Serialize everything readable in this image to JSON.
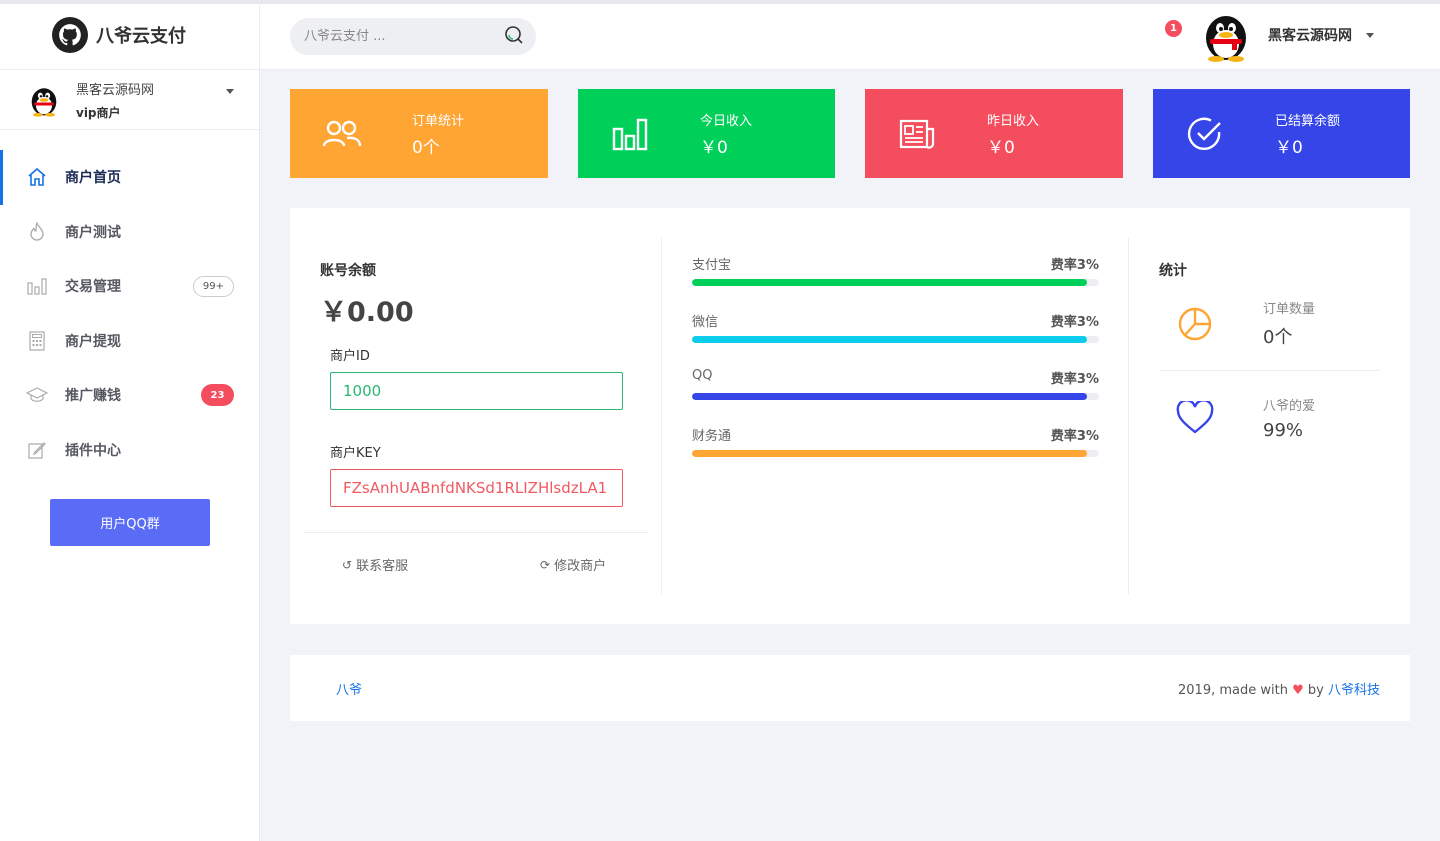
{
  "app": {
    "brand_title": "八爷云支付",
    "search_placeholder": "八爷云支付 ...",
    "notification_count": "1",
    "top_user_name": "黑客云源码网"
  },
  "sidebar": {
    "user_name": "黑客云源码网",
    "user_role": "vip商户",
    "items": [
      {
        "label": "商户首页",
        "icon": "home-icon",
        "active": true
      },
      {
        "label": "商户测试",
        "icon": "flame-icon"
      },
      {
        "label": "交易管理",
        "icon": "bar-chart-icon",
        "badge": "99+"
      },
      {
        "label": "商户提现",
        "icon": "calculator-icon"
      },
      {
        "label": "推广赚钱",
        "icon": "graduation-cap-icon",
        "badge": "23"
      },
      {
        "label": "插件中心",
        "icon": "edit-icon"
      }
    ],
    "qq_group_button": "用户QQ群"
  },
  "stats": [
    {
      "title": "订单统计",
      "value": "0个",
      "color": "#ffa534",
      "icon": "users-icon"
    },
    {
      "title": "今日收入",
      "value": "￥0",
      "color": "#00d05a",
      "icon": "bar-chart-icon"
    },
    {
      "title": "昨日收入",
      "value": "￥0",
      "color": "#f44d5e",
      "icon": "newspaper-icon"
    },
    {
      "title": "已结算余额",
      "value": "￥0",
      "color": "#3545e8",
      "icon": "check-circle-icon"
    }
  ],
  "account": {
    "title": "账号余额",
    "balance": "￥0.00",
    "merchant_id_label": "商户ID",
    "merchant_id": "1000",
    "merchant_key_label": "商户KEY",
    "merchant_key": "FZsAnhUABnfdNKSd1RLIZHlsdzLA1",
    "contact_link": "联系客服",
    "edit_link": "修改商户"
  },
  "channels": [
    {
      "name": "支付宝",
      "rate": "费率3%",
      "percent": 97,
      "color": "#00d05a"
    },
    {
      "name": "微信",
      "rate": "费率3%",
      "percent": 97,
      "color": "#0bcdeb"
    },
    {
      "name": "QQ",
      "rate": "费率3%",
      "percent": 97,
      "color": "#3545e8"
    },
    {
      "name": "财务通",
      "rate": "费率3%",
      "percent": 97,
      "color": "#ffa534"
    }
  ],
  "summary": {
    "title": "统计",
    "items": [
      {
        "label": "订单数量",
        "value": "0个",
        "icon": "pie-chart-icon",
        "color": "#ffa534"
      },
      {
        "label": "八爷的爱",
        "value": "99%",
        "icon": "heart-icon",
        "color": "#3545e8"
      }
    ]
  },
  "footer": {
    "left": "八爷",
    "right_prefix": "2019, made with",
    "heart": "♥",
    "by": "by",
    "right_brand": "八爷科技"
  }
}
